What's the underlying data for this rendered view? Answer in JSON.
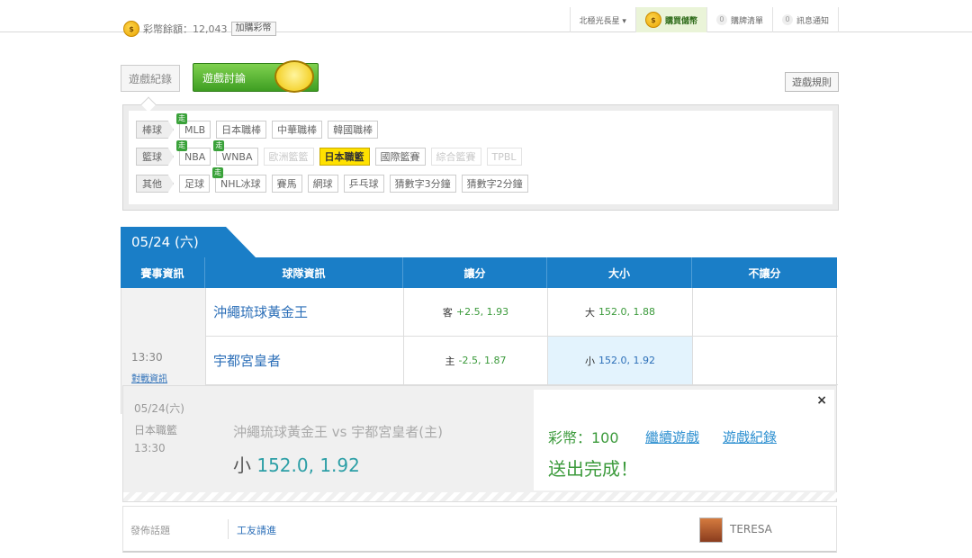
{
  "topbar": {
    "coins_label": "彩幣餘額：12,043",
    "add_coins": "加購彩幣",
    "coin_icon": "coin-icon",
    "nav": {
      "region": "北極光長星 ▾",
      "buy": "購買儲幣",
      "orders": "購牌清單",
      "orders_count": "0",
      "messages": "訊息通知",
      "messages_count": "0"
    }
  },
  "tabs": {
    "record": "遊戲紀錄",
    "discuss": "遊戲討論",
    "rules": "遊戲規則"
  },
  "filters": {
    "live_badge": "走",
    "rows": [
      {
        "category": "棒球",
        "items": [
          {
            "label": "MLB",
            "live": true
          },
          {
            "label": "日本職棒"
          },
          {
            "label": "中華職棒"
          },
          {
            "label": "韓國職棒"
          }
        ]
      },
      {
        "category": "籃球",
        "items": [
          {
            "label": "NBA",
            "live": true
          },
          {
            "label": "WNBA",
            "live": true
          },
          {
            "label": "歐洲籃籃",
            "disabled": true
          },
          {
            "label": "日本職籃",
            "active": true
          },
          {
            "label": "國際籃賽"
          },
          {
            "label": "綜合籃賽",
            "disabled": true
          },
          {
            "label": "TPBL",
            "disabled": true
          }
        ]
      },
      {
        "category": "其他",
        "items": [
          {
            "label": "足球"
          },
          {
            "label": "NHL冰球",
            "live": true
          },
          {
            "label": "賽馬"
          },
          {
            "label": "網球"
          },
          {
            "label": "乒乓球"
          },
          {
            "label": "猜數字3分鐘"
          },
          {
            "label": "猜數字2分鐘"
          }
        ]
      }
    ]
  },
  "match": {
    "date": "05/24 (六)",
    "headers": [
      "賽事資訊",
      "球隊資訊",
      "讓分",
      "大小",
      "不讓分"
    ],
    "time": "13:30",
    "link": "對戰資訊",
    "rows": [
      {
        "team": "沖繩琉球黃金王",
        "spread_side": "客",
        "spread_val": "+2.5, 1.93",
        "ou_side": "大",
        "ou_val": "152.0, 1.88"
      },
      {
        "team": "宇都宮皇者",
        "spread_side": "主",
        "spread_val": "-2.5, 1.87",
        "ou_side": "小",
        "ou_val": "152.0, 1.92"
      }
    ]
  },
  "confirm": {
    "date": "05/24(六)",
    "league": "日本職籃",
    "time": "13:30",
    "matchup": "沖繩琉球黃金王 vs 宇都宮皇者(主)",
    "pick_side": "小",
    "pick_val": "152.0, 1.92",
    "coins": "彩幣：100",
    "done": "送出完成！",
    "continue": "繼續遊戲",
    "record": "遊戲紀錄",
    "close": "×"
  },
  "bottom": {
    "post": "發佈話題",
    "friends": "工友請進",
    "user": "TERESA"
  }
}
